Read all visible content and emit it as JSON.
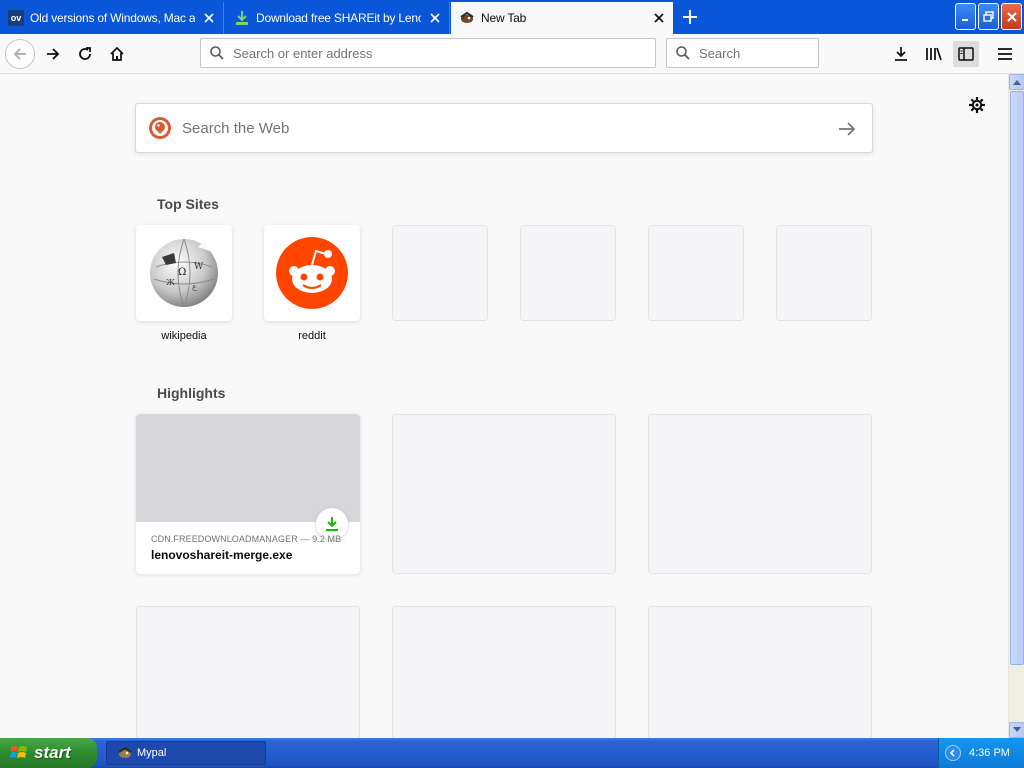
{
  "tabs": [
    {
      "title": "Old versions of Windows, Mac and",
      "favicon": "ov-favicon",
      "favicon_text": "ov",
      "active": false
    },
    {
      "title": "Download free SHAREit by Lenovo",
      "favicon": "download-favicon",
      "active": false
    },
    {
      "title": "New Tab",
      "favicon": "mypal-favicon",
      "active": true
    }
  ],
  "navbar": {
    "url_placeholder": "Search or enter address",
    "search_placeholder": "Search"
  },
  "newtab": {
    "web_search_placeholder": "Search the Web",
    "top_sites_title": "Top Sites",
    "top_sites": [
      {
        "label": "wikipedia",
        "icon": "wikipedia-globe-icon"
      },
      {
        "label": "reddit",
        "icon": "reddit-alien-icon"
      },
      {
        "label": "",
        "icon": ""
      },
      {
        "label": "",
        "icon": ""
      },
      {
        "label": "",
        "icon": ""
      },
      {
        "label": "",
        "icon": ""
      }
    ],
    "highlights_title": "Highlights",
    "highlights": [
      {
        "meta": "CDN.FREEDOWNLOADMANAGER — 9.2 MB",
        "title": "lenovoshareit-merge.exe",
        "icon": "download-arrow-icon"
      }
    ]
  },
  "taskbar": {
    "start_label": "start",
    "task_item": "Mypal",
    "clock": "4:36 PM"
  },
  "colors": {
    "tabstrip": "#0a56d8",
    "reddit": "#ff4500",
    "download_green": "#12bc00"
  }
}
